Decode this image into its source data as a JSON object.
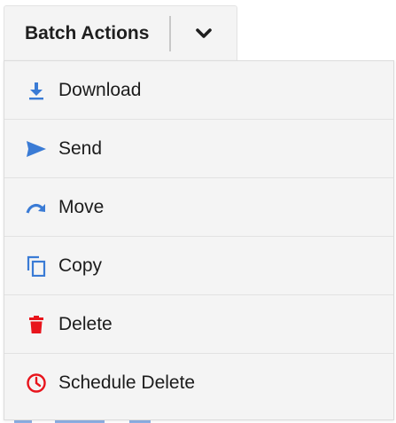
{
  "batch": {
    "label": "Batch Actions"
  },
  "menu": {
    "items": [
      {
        "label": "Download",
        "icon": "download-icon",
        "icon_color": "#3a7bd5"
      },
      {
        "label": "Send",
        "icon": "send-icon",
        "icon_color": "#3a7bd5"
      },
      {
        "label": "Move",
        "icon": "move-icon",
        "icon_color": "#3a7bd5"
      },
      {
        "label": "Copy",
        "icon": "copy-icon",
        "icon_color": "#3a7bd5"
      },
      {
        "label": "Delete",
        "icon": "trash-icon",
        "icon_color": "#e8141c"
      },
      {
        "label": "Schedule Delete",
        "icon": "clock-icon",
        "icon_color": "#e8141c"
      }
    ]
  },
  "colors": {
    "accent_blue": "#3a7bd5",
    "danger_red": "#e8141c",
    "menu_bg": "#f4f4f4"
  }
}
